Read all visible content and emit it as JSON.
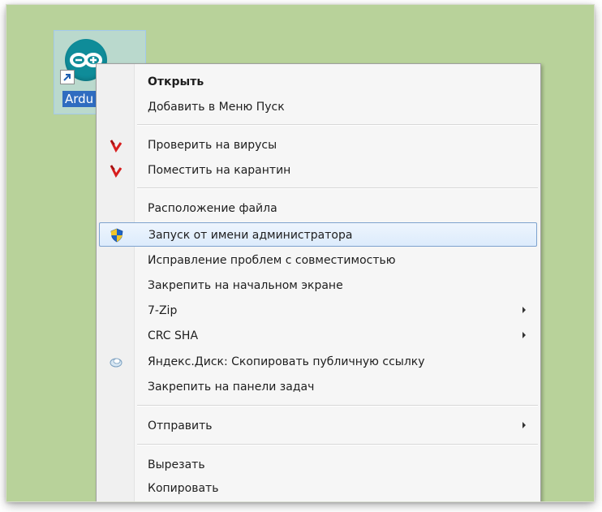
{
  "desktop": {
    "icon_label": "Ardu",
    "icon_name": "arduino-icon",
    "background_color": "#b8d29a"
  },
  "context_menu": {
    "items": [
      {
        "label": "Открыть",
        "bold": true
      },
      {
        "label": "Добавить в Меню Пуск"
      },
      {
        "label": "Проверить на вирусы",
        "icon": "kaspersky-icon"
      },
      {
        "label": "Поместить на карантин",
        "icon": "kaspersky-icon"
      },
      {
        "label": "Расположение файла"
      },
      {
        "label": "Запуск от имени администратора",
        "icon": "uac-shield-icon",
        "highlighted": true
      },
      {
        "label": "Исправление проблем с совместимостью"
      },
      {
        "label": "Закрепить на начальном экране"
      },
      {
        "label": "7-Zip",
        "submenu": true
      },
      {
        "label": "CRC SHA",
        "submenu": true
      },
      {
        "label": "Яндекс.Диск: Скопировать публичную ссылку",
        "icon": "yandex-disk-icon"
      },
      {
        "label": "Закрепить на панели задач"
      },
      {
        "label": "Отправить",
        "submenu": true
      },
      {
        "label": "Вырезать"
      },
      {
        "label": "Копировать"
      }
    ],
    "highlight_color": "#dcebfc",
    "kaspersky_color": "#d81e1e"
  }
}
